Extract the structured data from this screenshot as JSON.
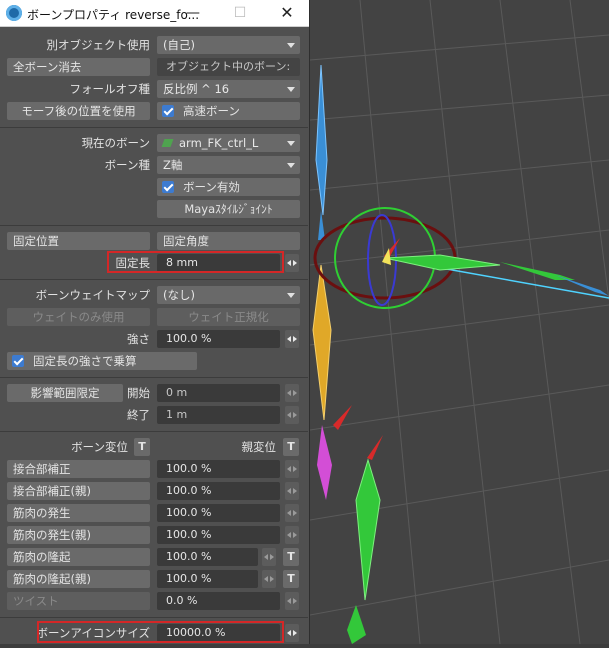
{
  "window": {
    "title": "ボーンプロパティ reverse_fo...",
    "minimize": "—",
    "maximize": "☐",
    "close": "✕",
    "icon": "lightwave-logo-icon"
  },
  "object_use": {
    "label": "別オブジェクト使用",
    "value": "(自己)"
  },
  "clear_all": {
    "label": "全ボーン消去",
    "value": "オブジェクト中のボーン:"
  },
  "falloff": {
    "label": "フォールオフ種",
    "value": "反比例 ^ 16"
  },
  "morph_pos": {
    "label": "モーフ後の位置を使用",
    "fast_bone": "高速ボーン"
  },
  "current_bone": {
    "label": "現在のボーン",
    "value": "arm_FK_ctrl_L"
  },
  "bone_type": {
    "label": "ボーン種",
    "value": "Z軸"
  },
  "bone_active": {
    "label": "ボーン有効"
  },
  "maya_joint": {
    "label": "Mayaｽﾀｲﾙｼﾞｮｲﾝﾄ"
  },
  "rest": {
    "position": "固定位置",
    "angle": "固定角度",
    "length_label": "固定長",
    "length_value": "8 mm"
  },
  "weight_map": {
    "label": "ボーンウェイトマップ",
    "value": "(なし)",
    "only": "ウェイトのみ使用",
    "normalize": "ウェイト正規化"
  },
  "strength": {
    "label": "強さ",
    "value": "100.0 %",
    "multiply": "固定長の強さで乗算"
  },
  "influence": {
    "label": "影響範囲限定",
    "start_label": "開始",
    "start_value": "0 m",
    "end_label": "終了",
    "end_value": "1 m"
  },
  "bone_twist_label": "ボーン変位",
  "parent_twist_label": "親変位",
  "t": "T",
  "joint_comp": {
    "label": "接合部補正",
    "value": "100.0 %"
  },
  "joint_comp_parent": {
    "label": "接合部補正(親)",
    "value": "100.0 %"
  },
  "muscle_flex": {
    "label": "筋肉の発生",
    "value": "100.0 %"
  },
  "muscle_flex_parent": {
    "label": "筋肉の発生(親)",
    "value": "100.0 %"
  },
  "muscle_bulge": {
    "label": "筋肉の隆起",
    "value": "100.0 %"
  },
  "muscle_bulge_parent": {
    "label": "筋肉の隆起(親)",
    "value": "100.0 %"
  },
  "twist": {
    "label": "ツイスト",
    "value": "0.0 %"
  },
  "icon_size": {
    "label": "ボーンアイコンサイズ",
    "value": "10000.0 %"
  },
  "colors": {
    "highlight": "#d42727",
    "panel": "#505050",
    "check": "#3d7bd0"
  }
}
